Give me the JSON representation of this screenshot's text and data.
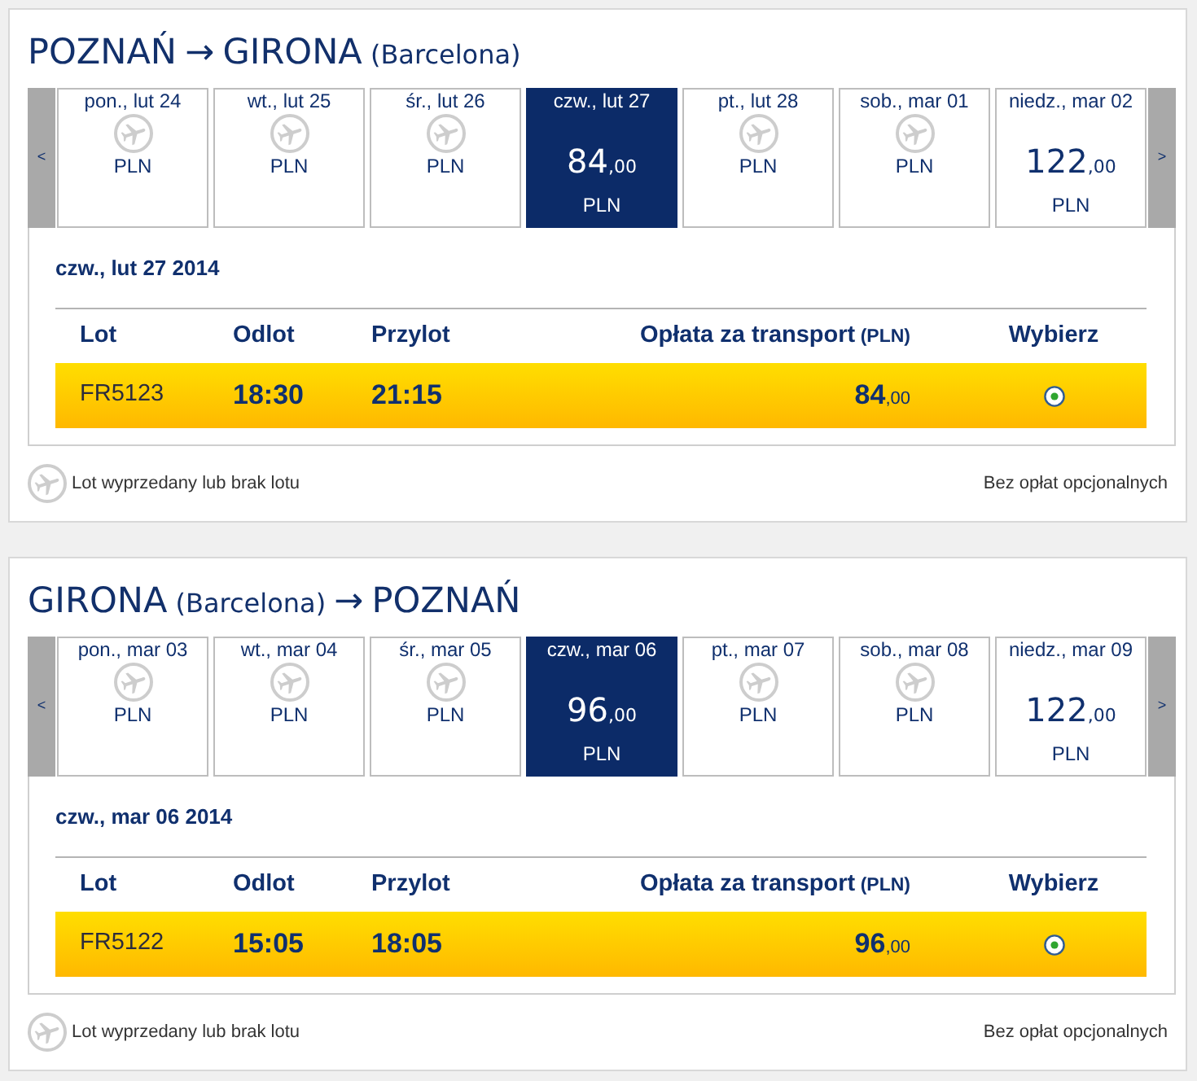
{
  "segments": [
    {
      "title": [
        {
          "kind": "city",
          "text": "POZNAŃ"
        },
        {
          "kind": "arrow",
          "text": "→"
        },
        {
          "kind": "city",
          "text": "GIRONA"
        },
        {
          "kind": "note",
          "text": "(Barcelona)"
        }
      ],
      "prev_button": "<",
      "next_button": ">",
      "days": [
        {
          "label": "pon., lut 24",
          "kind": "no_flight",
          "currency": "PLN",
          "selected": false
        },
        {
          "label": "wt., lut 25",
          "kind": "no_flight",
          "currency": "PLN",
          "selected": false
        },
        {
          "label": "śr., lut 26",
          "kind": "no_flight",
          "currency": "PLN",
          "selected": false
        },
        {
          "label": "czw., lut 27",
          "kind": "fare",
          "amount": "84",
          "fraction": ",00",
          "currency": "PLN",
          "selected": true
        },
        {
          "label": "pt., lut 28",
          "kind": "no_flight",
          "currency": "PLN",
          "selected": false
        },
        {
          "label": "sob., mar 01",
          "kind": "no_flight",
          "currency": "PLN",
          "selected": false
        },
        {
          "label": "niedz., mar 02",
          "kind": "fare",
          "amount": "122",
          "fraction": ",00",
          "currency": "PLN",
          "selected": false
        }
      ],
      "date_heading": "czw., lut 27 2014",
      "columns": [
        {
          "label": "Lot"
        },
        {
          "label": "Odlot"
        },
        {
          "label": "Przylot"
        },
        {
          "label": "Opłata za transport",
          "unit": "(PLN)"
        },
        {
          "label": "Wybierz"
        }
      ],
      "flights": [
        {
          "number": "FR5123",
          "departure": "18:30",
          "arrival": "21:15",
          "amount": "84",
          "fraction": ",00",
          "selected": true
        }
      ],
      "legend": "Lot wyprzedany lub brak lotu",
      "note": "Bez opłat opcjonalnych"
    },
    {
      "title": [
        {
          "kind": "city",
          "text": "GIRONA"
        },
        {
          "kind": "note",
          "text": "(Barcelona)"
        },
        {
          "kind": "arrow",
          "text": "→"
        },
        {
          "kind": "city",
          "text": "POZNAŃ"
        }
      ],
      "prev_button": "<",
      "next_button": ">",
      "days": [
        {
          "label": "pon., mar 03",
          "kind": "no_flight",
          "currency": "PLN",
          "selected": false
        },
        {
          "label": "wt., mar 04",
          "kind": "no_flight",
          "currency": "PLN",
          "selected": false
        },
        {
          "label": "śr., mar 05",
          "kind": "no_flight",
          "currency": "PLN",
          "selected": false
        },
        {
          "label": "czw., mar 06",
          "kind": "fare",
          "amount": "96",
          "fraction": ",00",
          "currency": "PLN",
          "selected": true
        },
        {
          "label": "pt., mar 07",
          "kind": "no_flight",
          "currency": "PLN",
          "selected": false
        },
        {
          "label": "sob., mar 08",
          "kind": "no_flight",
          "currency": "PLN",
          "selected": false
        },
        {
          "label": "niedz., mar 09",
          "kind": "fare",
          "amount": "122",
          "fraction": ",00",
          "currency": "PLN",
          "selected": false
        }
      ],
      "date_heading": "czw., mar 06 2014",
      "columns": [
        {
          "label": "Lot"
        },
        {
          "label": "Odlot"
        },
        {
          "label": "Przylot"
        },
        {
          "label": "Opłata za transport",
          "unit": "(PLN)"
        },
        {
          "label": "Wybierz"
        }
      ],
      "flights": [
        {
          "number": "FR5122",
          "departure": "15:05",
          "arrival": "18:05",
          "amount": "96",
          "fraction": ",00",
          "selected": true
        }
      ],
      "legend": "Lot wyprzedany lub brak lotu",
      "note": "Bez opłat opcjonalnych"
    }
  ]
}
